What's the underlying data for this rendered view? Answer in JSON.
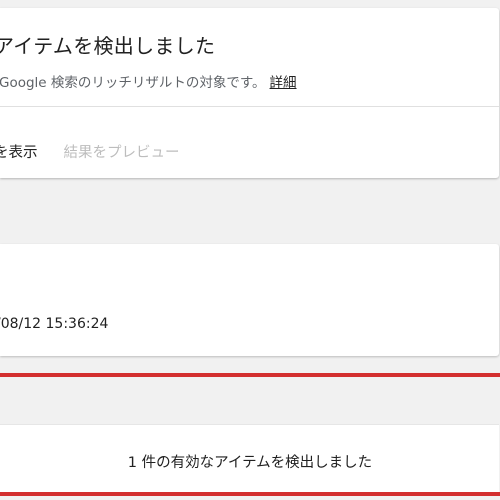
{
  "top_card": {
    "heading": "アイテムを検出しました",
    "subtext": "Google 検索のリッチリザルトの対象です。",
    "details_link": "詳細",
    "view_action": "を表示",
    "preview_action": "結果をプレビュー"
  },
  "mid_card": {
    "timestamp": "/08/12 15:36:24"
  },
  "bottom_card": {
    "result": "1 件の有効なアイテムを検出しました"
  },
  "colors": {
    "highlight_red": "#d32f2f",
    "text_primary": "#212121",
    "text_secondary": "#5f6368",
    "text_disabled": "#bdbdbd"
  }
}
